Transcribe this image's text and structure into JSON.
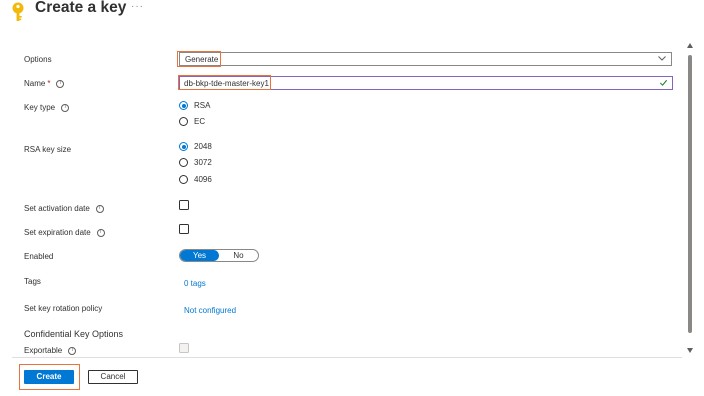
{
  "header": {
    "title": "Create a key",
    "more_label": "···"
  },
  "form": {
    "options": {
      "label": "Options",
      "value": "Generate"
    },
    "name": {
      "label": "Name",
      "required_mark": "*",
      "value": "db-bkp-tde-master-key1"
    },
    "key_type": {
      "label": "Key type",
      "choices": [
        "RSA",
        "EC"
      ],
      "selected": "RSA"
    },
    "rsa_key_size": {
      "label": "RSA key size",
      "choices": [
        "2048",
        "3072",
        "4096"
      ],
      "selected": "2048"
    },
    "activation_date": {
      "label": "Set activation date",
      "checked": false
    },
    "expiration_date": {
      "label": "Set expiration date",
      "checked": false
    },
    "enabled": {
      "label": "Enabled",
      "options": [
        "Yes",
        "No"
      ],
      "selected": "Yes"
    },
    "tags": {
      "label": "Tags",
      "value": "0 tags"
    },
    "rotation_policy": {
      "label": "Set key rotation policy",
      "value": "Not configured"
    },
    "confidential_section": {
      "title": "Confidential Key Options"
    },
    "exportable": {
      "label": "Exportable",
      "checked": false
    }
  },
  "footer": {
    "create_label": "Create",
    "cancel_label": "Cancel"
  },
  "colors": {
    "accent": "#0078d4",
    "highlight": "#e8743b",
    "key_icon": "#f2b90c"
  },
  "icons": [
    "key-icon",
    "more-icon",
    "info-icon",
    "chevron-down-icon",
    "checkmark-icon"
  ]
}
